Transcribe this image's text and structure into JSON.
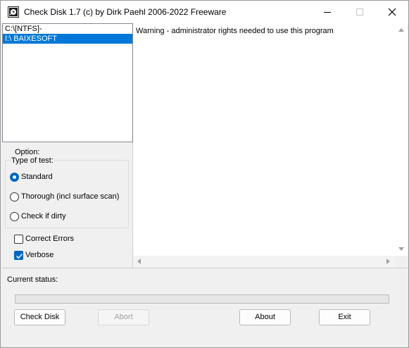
{
  "window": {
    "title": "Check Disk 1.7  (c) by Dirk Paehl  2006-2022 Freeware",
    "icon": "check-disk-app-icon"
  },
  "drives": [
    {
      "label": "C:\\[NTFS]-",
      "selected": false
    },
    {
      "label": "I:\\ BAIXESOFT",
      "selected": true
    }
  ],
  "options": {
    "label": "Option:",
    "type_of_test_label": "Type of test:",
    "radios": [
      {
        "label": "Standard",
        "checked": true
      },
      {
        "label": "Thorough (incl surface scan)",
        "checked": false
      },
      {
        "label": "Check if dirty",
        "checked": false
      }
    ],
    "checkboxes": [
      {
        "label": "Correct Errors",
        "checked": false
      },
      {
        "label": "Verbose",
        "checked": true
      }
    ]
  },
  "log": {
    "lines": [
      "Warning - administrator rights needed to use this program"
    ]
  },
  "status": {
    "label": "Current status:",
    "progress_fraction": 0
  },
  "buttons": {
    "check_disk": "Check Disk",
    "abort": "Abort",
    "about": "About",
    "exit": "Exit"
  },
  "colors": {
    "selection": "#0078d7",
    "accent": "#0067c0",
    "window_bg": "#f0f0f0"
  }
}
